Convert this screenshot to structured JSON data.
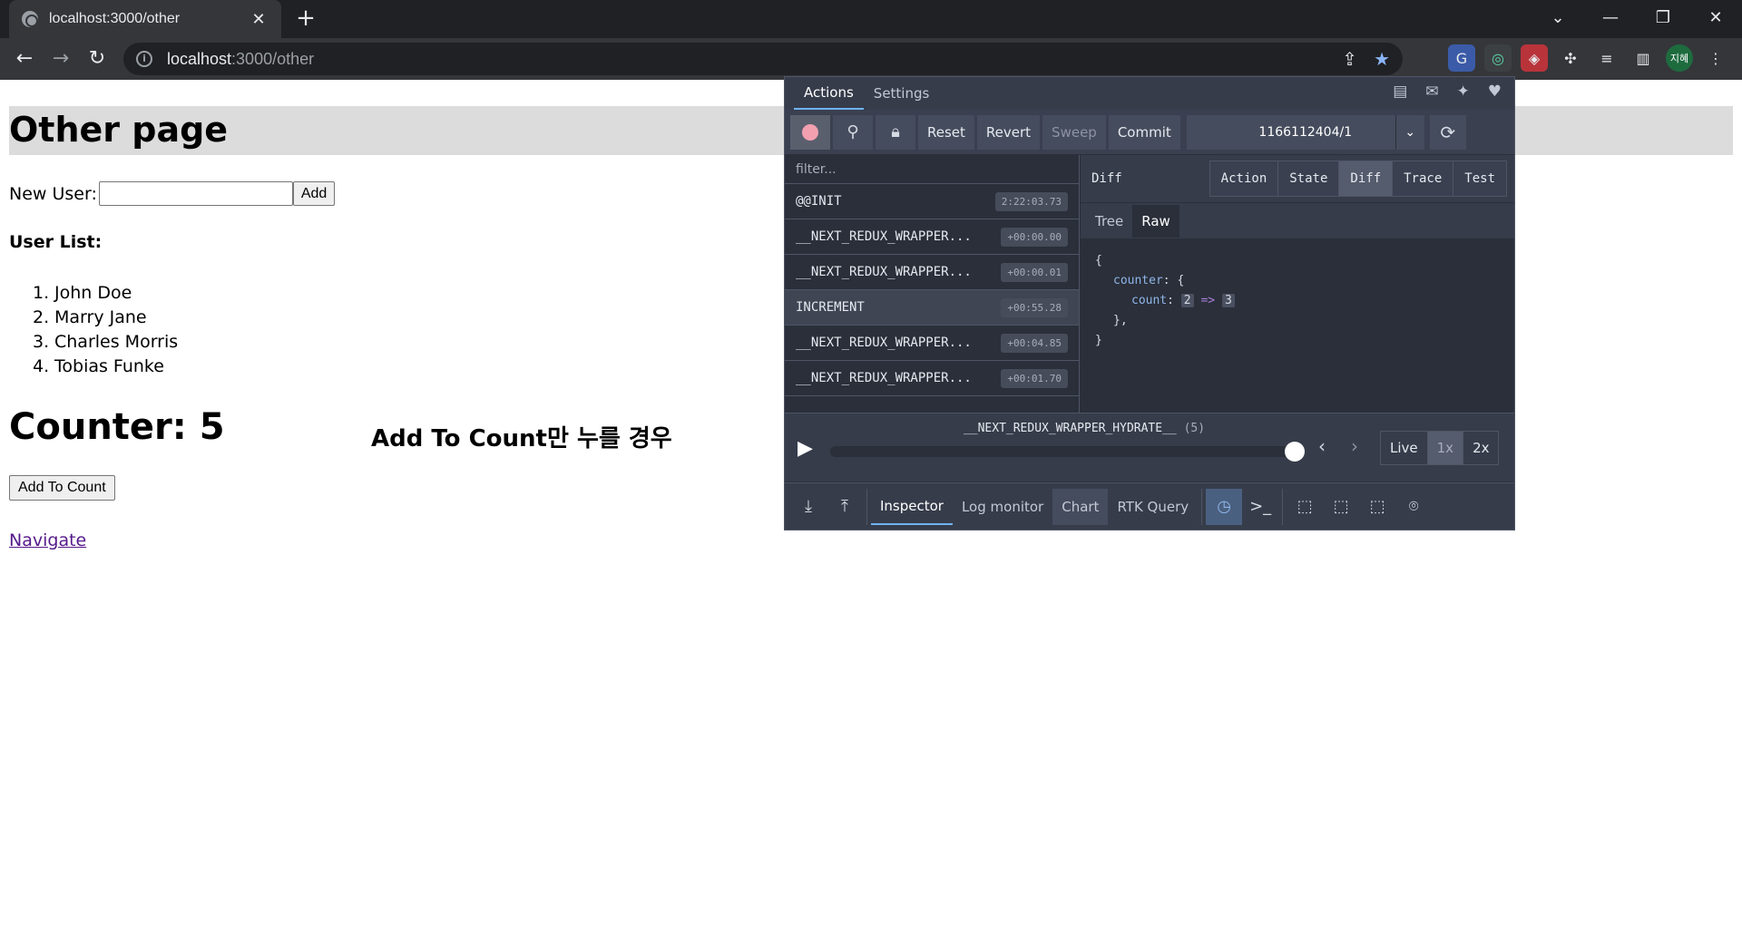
{
  "browser": {
    "tab_title": "localhost:3000/other",
    "tab_close": "✕",
    "new_tab": "+",
    "url_host": "localhost",
    "url_path": ":3000/other",
    "profile_label": "지혜"
  },
  "page": {
    "title": "Other page",
    "new_user_label": "New User:",
    "new_user_value": "",
    "add_label": "Add",
    "user_list_title": "User List:",
    "users": [
      "John Doe",
      "Marry Jane",
      "Charles Morris",
      "Tobias Funke"
    ],
    "counter_text": "Counter: 5",
    "annotation": "Add To Count만 누를 경우",
    "add_to_count_label": "Add To Count",
    "navigate_label": "Navigate"
  },
  "devtools": {
    "tabs": [
      "Actions",
      "Settings"
    ],
    "toolbar_buttons": [
      "Reset",
      "Revert",
      "Sweep",
      "Commit"
    ],
    "instance": "1166112404/1",
    "filter_placeholder": "filter...",
    "actions": [
      {
        "name": "@@INIT",
        "time": "2:22:03.73"
      },
      {
        "name": "__NEXT_REDUX_WRAPPER...",
        "time": "+00:00.00"
      },
      {
        "name": "__NEXT_REDUX_WRAPPER...",
        "time": "+00:00.01"
      },
      {
        "name": "INCREMENT",
        "time": "+00:55.28"
      },
      {
        "name": "__NEXT_REDUX_WRAPPER...",
        "time": "+00:04.85"
      },
      {
        "name": "__NEXT_REDUX_WRAPPER...",
        "time": "+00:01.70"
      }
    ],
    "diff_label": "Diff",
    "view_tabs": [
      "Action",
      "State",
      "Diff",
      "Trace",
      "Test"
    ],
    "sub_tabs": [
      "Tree",
      "Raw"
    ],
    "diff": {
      "open": "{",
      "key1": "counter",
      "key2": "count",
      "old_value": "2",
      "arrow": "=>",
      "new_value": "3",
      "close_inner": "},",
      "close": "}"
    },
    "slider_label": "__NEXT_REDUX_WRAPPER_HYDRATE__",
    "slider_count": "(5)",
    "slider_position": 1.0,
    "speed_options": [
      "Live",
      "1x",
      "2x"
    ],
    "monitors": [
      "Inspector",
      "Log monitor",
      "Chart",
      "RTK Query"
    ]
  }
}
